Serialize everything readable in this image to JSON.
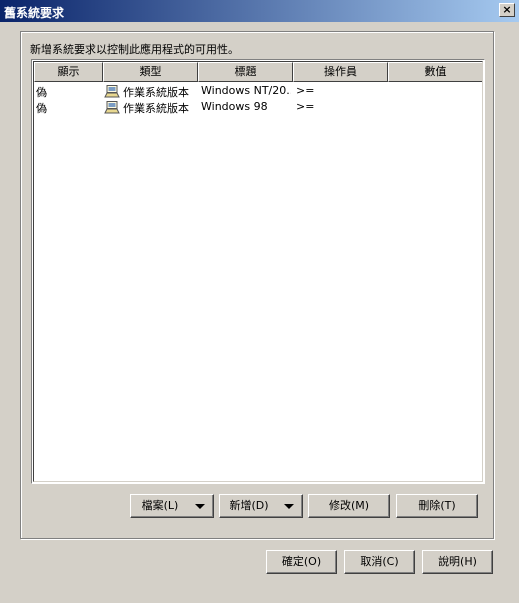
{
  "window": {
    "title": "舊系統要求",
    "close_glyph": "×"
  },
  "description": "新增系統要求以控制此應用程式的可用性。",
  "table": {
    "columns": [
      "顯示",
      "類型",
      "標題",
      "操作員",
      "數值"
    ],
    "rows": [
      {
        "show": "偽",
        "type": "作業系統版本",
        "title": "Windows NT/20...",
        "operator": ">=",
        "value": ""
      },
      {
        "show": "偽",
        "type": "作業系統版本",
        "title": "Windows 98",
        "operator": ">=",
        "value": ""
      }
    ]
  },
  "buttons": {
    "file": "檔案(L)",
    "add": "新增(D)",
    "modify": "修改(M)",
    "delete": "刪除(T)",
    "ok": "確定(O)",
    "cancel": "取消(C)",
    "help": "說明(H)"
  },
  "icons": {
    "row_type": "os-computer-icon",
    "dropdown": "chevron-down-icon"
  }
}
